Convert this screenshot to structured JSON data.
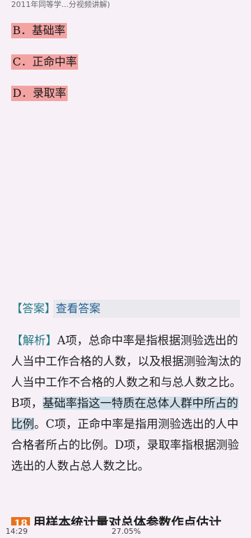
{
  "header": {
    "title_truncated": "2011年同等学...分视频讲解)"
  },
  "options": [
    {
      "label": "B．基础率"
    },
    {
      "label": "C．正命中率"
    },
    {
      "label": "D．录取率"
    }
  ],
  "answer": {
    "tag": "【答案】",
    "button": "查看答案"
  },
  "analysis": {
    "tag": "【解析】",
    "text_a": "A项，总命中率是指根据测验选出的人当中工作合格的人数，以及根据测验淘汰的人当中工作不合格的人数之和与总人数之比。B项，",
    "highlight": "基础率指这一特质在总体人群中所占的比例",
    "text_b": "。C项，正命中率是指用测验选出的人中合格者所占的比例。D项，录取率指根据测验选出的人数占总人数之比。"
  },
  "next_question": {
    "number": "18",
    "text": "用样本统计量对总体参数作点估计"
  },
  "status": {
    "time": "14:29",
    "progress": "27.05%"
  }
}
